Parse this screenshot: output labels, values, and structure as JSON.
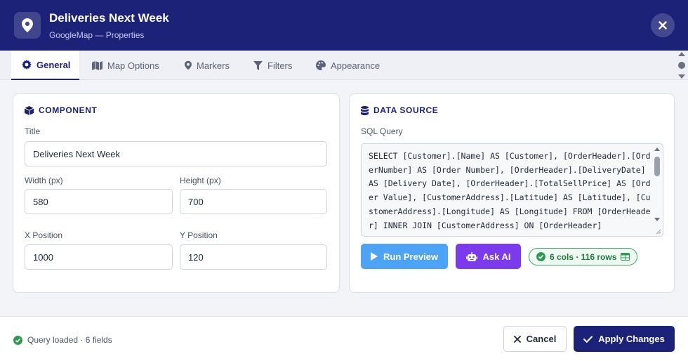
{
  "header": {
    "title": "Deliveries Next Week",
    "subtitle": "GoogleMap — Properties",
    "icon": "map-pin-icon",
    "close_icon": "close-icon"
  },
  "tabs": [
    {
      "label": "General",
      "icon": "gear-icon",
      "active": true
    },
    {
      "label": "Map Options",
      "icon": "map-icon",
      "active": false
    },
    {
      "label": "Markers",
      "icon": "map-pin-icon",
      "active": false
    },
    {
      "label": "Filters",
      "icon": "filter-icon",
      "active": false
    },
    {
      "label": "Appearance",
      "icon": "palette-icon",
      "active": false
    }
  ],
  "component": {
    "heading": "COMPONENT",
    "icon": "cube-icon",
    "title_label": "Title",
    "title_value": "Deliveries Next Week",
    "width_label": "Width (px)",
    "width_value": "580",
    "height_label": "Height (px)",
    "height_value": "700",
    "x_label": "X Position",
    "x_value": "1000",
    "y_label": "Y Position",
    "y_value": "120"
  },
  "datasource": {
    "heading": "DATA SOURCE",
    "icon": "database-icon",
    "sql_label": "SQL Query",
    "sql": "SELECT [Customer].[Name] AS [Customer], [OrderHeader].[OrderNumber] AS [Order Number], [OrderHeader].[DeliveryDate] AS [Delivery Date], [OrderHeader].[TotalSellPrice] AS [Order Value], [CustomerAddress].[Latitude] AS [Latitude], [CustomerAddress].[Longitude] AS [Longitude] FROM [OrderHeader] INNER JOIN [CustomerAddress] ON [OrderHeader]",
    "run_label": "Run Preview",
    "ai_label": "Ask AI",
    "stat": "6 cols · 116 rows"
  },
  "footer": {
    "status": "Query loaded · 6 fields",
    "cancel_label": "Cancel",
    "apply_label": "Apply Changes"
  },
  "colors": {
    "brand": "#1c2277",
    "run": "#4da3f5",
    "ai": "#7c3aed",
    "success": "#3fae64"
  }
}
